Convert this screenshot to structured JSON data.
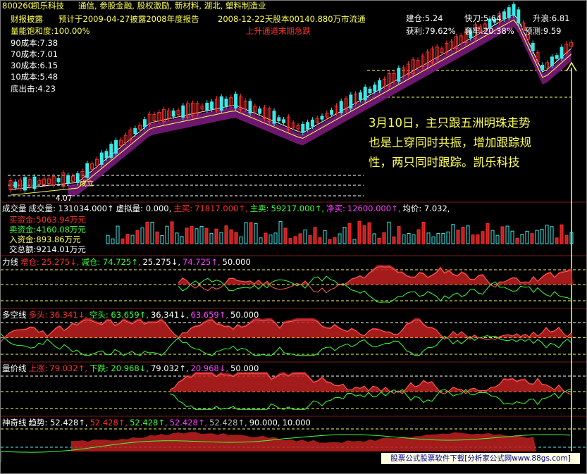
{
  "header": {
    "code": "800260",
    "name": "凯乐科技",
    "concepts": "通信, 参股金融, 股权激励, 新材料, 湖北, 塑料制造业",
    "line2_left": "财报披露",
    "line2_mid": "预计于2009-04-27披露2008年度报告",
    "line2_right": "2008-12-22天股本00140.880万市流通",
    "saturation": "量能饱和度:100.00%",
    "warning": "上升通道末期急跌"
  },
  "cost_lines": [
    {
      "label": "90成本:7.38"
    },
    {
      "label": "70成本:7.01"
    },
    {
      "label": "30成本:6.15"
    },
    {
      "label": "10成本:5.48"
    },
    {
      "label": "底出击:4.23"
    }
  ],
  "right_stats": {
    "build": "建仓:5.24",
    "fast": "快刀:5.64",
    "rise": "升浪:6.81",
    "profit": "获利:79.62%",
    "mid": "套牢:20.38%",
    "predict": "预测:9.59"
  },
  "price_labels": {
    "low": "4.07",
    "mark": "成立"
  },
  "annotation": {
    "line1": "3月10日，主只跟五洲明珠走势",
    "line2": "也是上穿同时共振，增加跟踪规",
    "line3": "性，两只同时跟踪。凯乐科技"
  },
  "volume_panel": {
    "name": "成交量",
    "title": "成交量: 131034.000↑",
    "virtual": "虚拟量: 0.000,",
    "buy_label": "主买:",
    "buy_val": "71817.000↑,",
    "sell_label": "主卖:",
    "sell_val": "59217.000↑,",
    "net_label": "净买:",
    "net_val": "12600.000↑,",
    "avg": "均价: 7.032,",
    "funds": [
      {
        "label": "买资金:5063.94万元"
      },
      {
        "label": "卖资金:4160.08万元"
      },
      {
        "label": "入资金:893.86万元"
      },
      {
        "label": "交总额:9214.01万元"
      }
    ]
  },
  "panel_strength": {
    "name": "力线",
    "add_label": "增仓:",
    "add_val": "25.275↓,",
    "reduce": "减仓: 74.725↑,",
    "v1": "25.275↓,",
    "v2": "74.725↑,",
    "level": "50.000"
  },
  "panel_bullbear": {
    "name": "多空线",
    "bull_label": "多头:",
    "bull_val": "36.341↓,",
    "bear": "空头: 63.659↑,",
    "v1": "36.341↓,",
    "v2": "63.659↑,",
    "level": "50.000"
  },
  "panel_volprice": {
    "name": "量价线",
    "up_label": "上涨:",
    "up_val": "79.032↑,",
    "down": "下跌: 20.968↓,",
    "v1": "79.032↑,",
    "v2": "20.968↓,",
    "level": "50.000"
  },
  "panel_magic": {
    "name": "神奇线",
    "trend": "趋势: 52.428↑,",
    "v1": "52.428↑,",
    "v2": "52.428↑,",
    "v3": "52.428↑,",
    "v4": "52.428↑,",
    "l1": "90.000,",
    "l2": "10.000"
  },
  "footer": "股票公式股票软件下载[分析家公式网www.88gs.com]",
  "colors": {
    "up": "#ff3030",
    "down": "#3ce8e8",
    "ribbon": "#7a1a7a",
    "yellow": "#ffff54",
    "green": "#3cff3c",
    "red_fill": "#c02020"
  }
}
